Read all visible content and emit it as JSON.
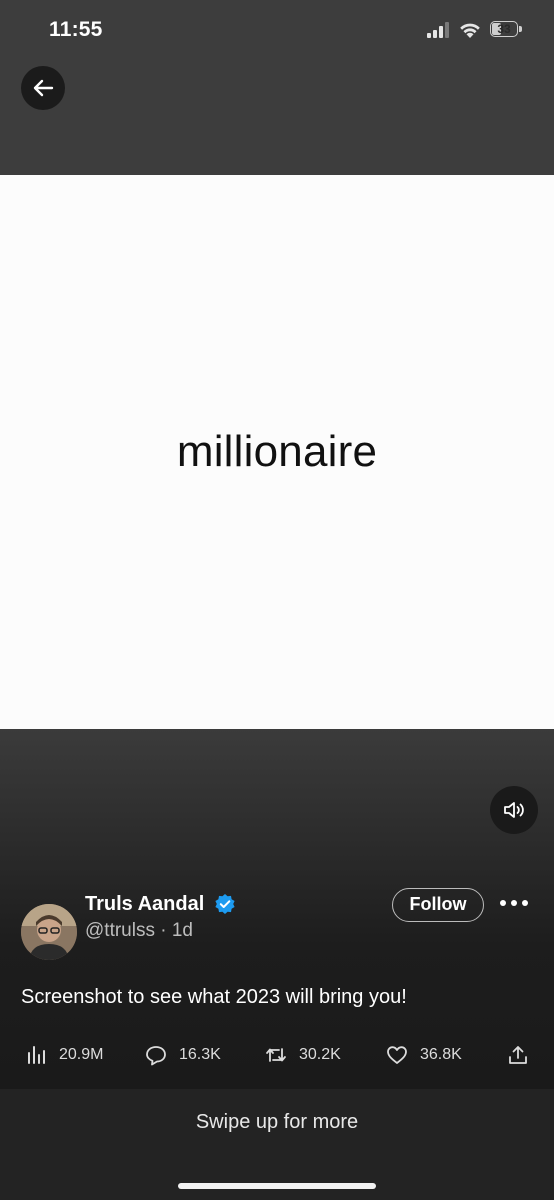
{
  "status_bar": {
    "time": "11:55",
    "battery": "33"
  },
  "media": {
    "word": "millionaire"
  },
  "post": {
    "author_name": "Truls Aandal",
    "handle_time": "@ttrulss · 1d",
    "follow_label": "Follow",
    "text": "Screenshot to see what 2023 will bring you!",
    "views": "20.9M",
    "replies": "16.3K",
    "reposts": "30.2K",
    "likes": "36.8K"
  },
  "footer": {
    "swipe_label": "Swipe up for more"
  },
  "colors": {
    "verified": "#1d9bf0",
    "background": "#1a1a1a"
  }
}
